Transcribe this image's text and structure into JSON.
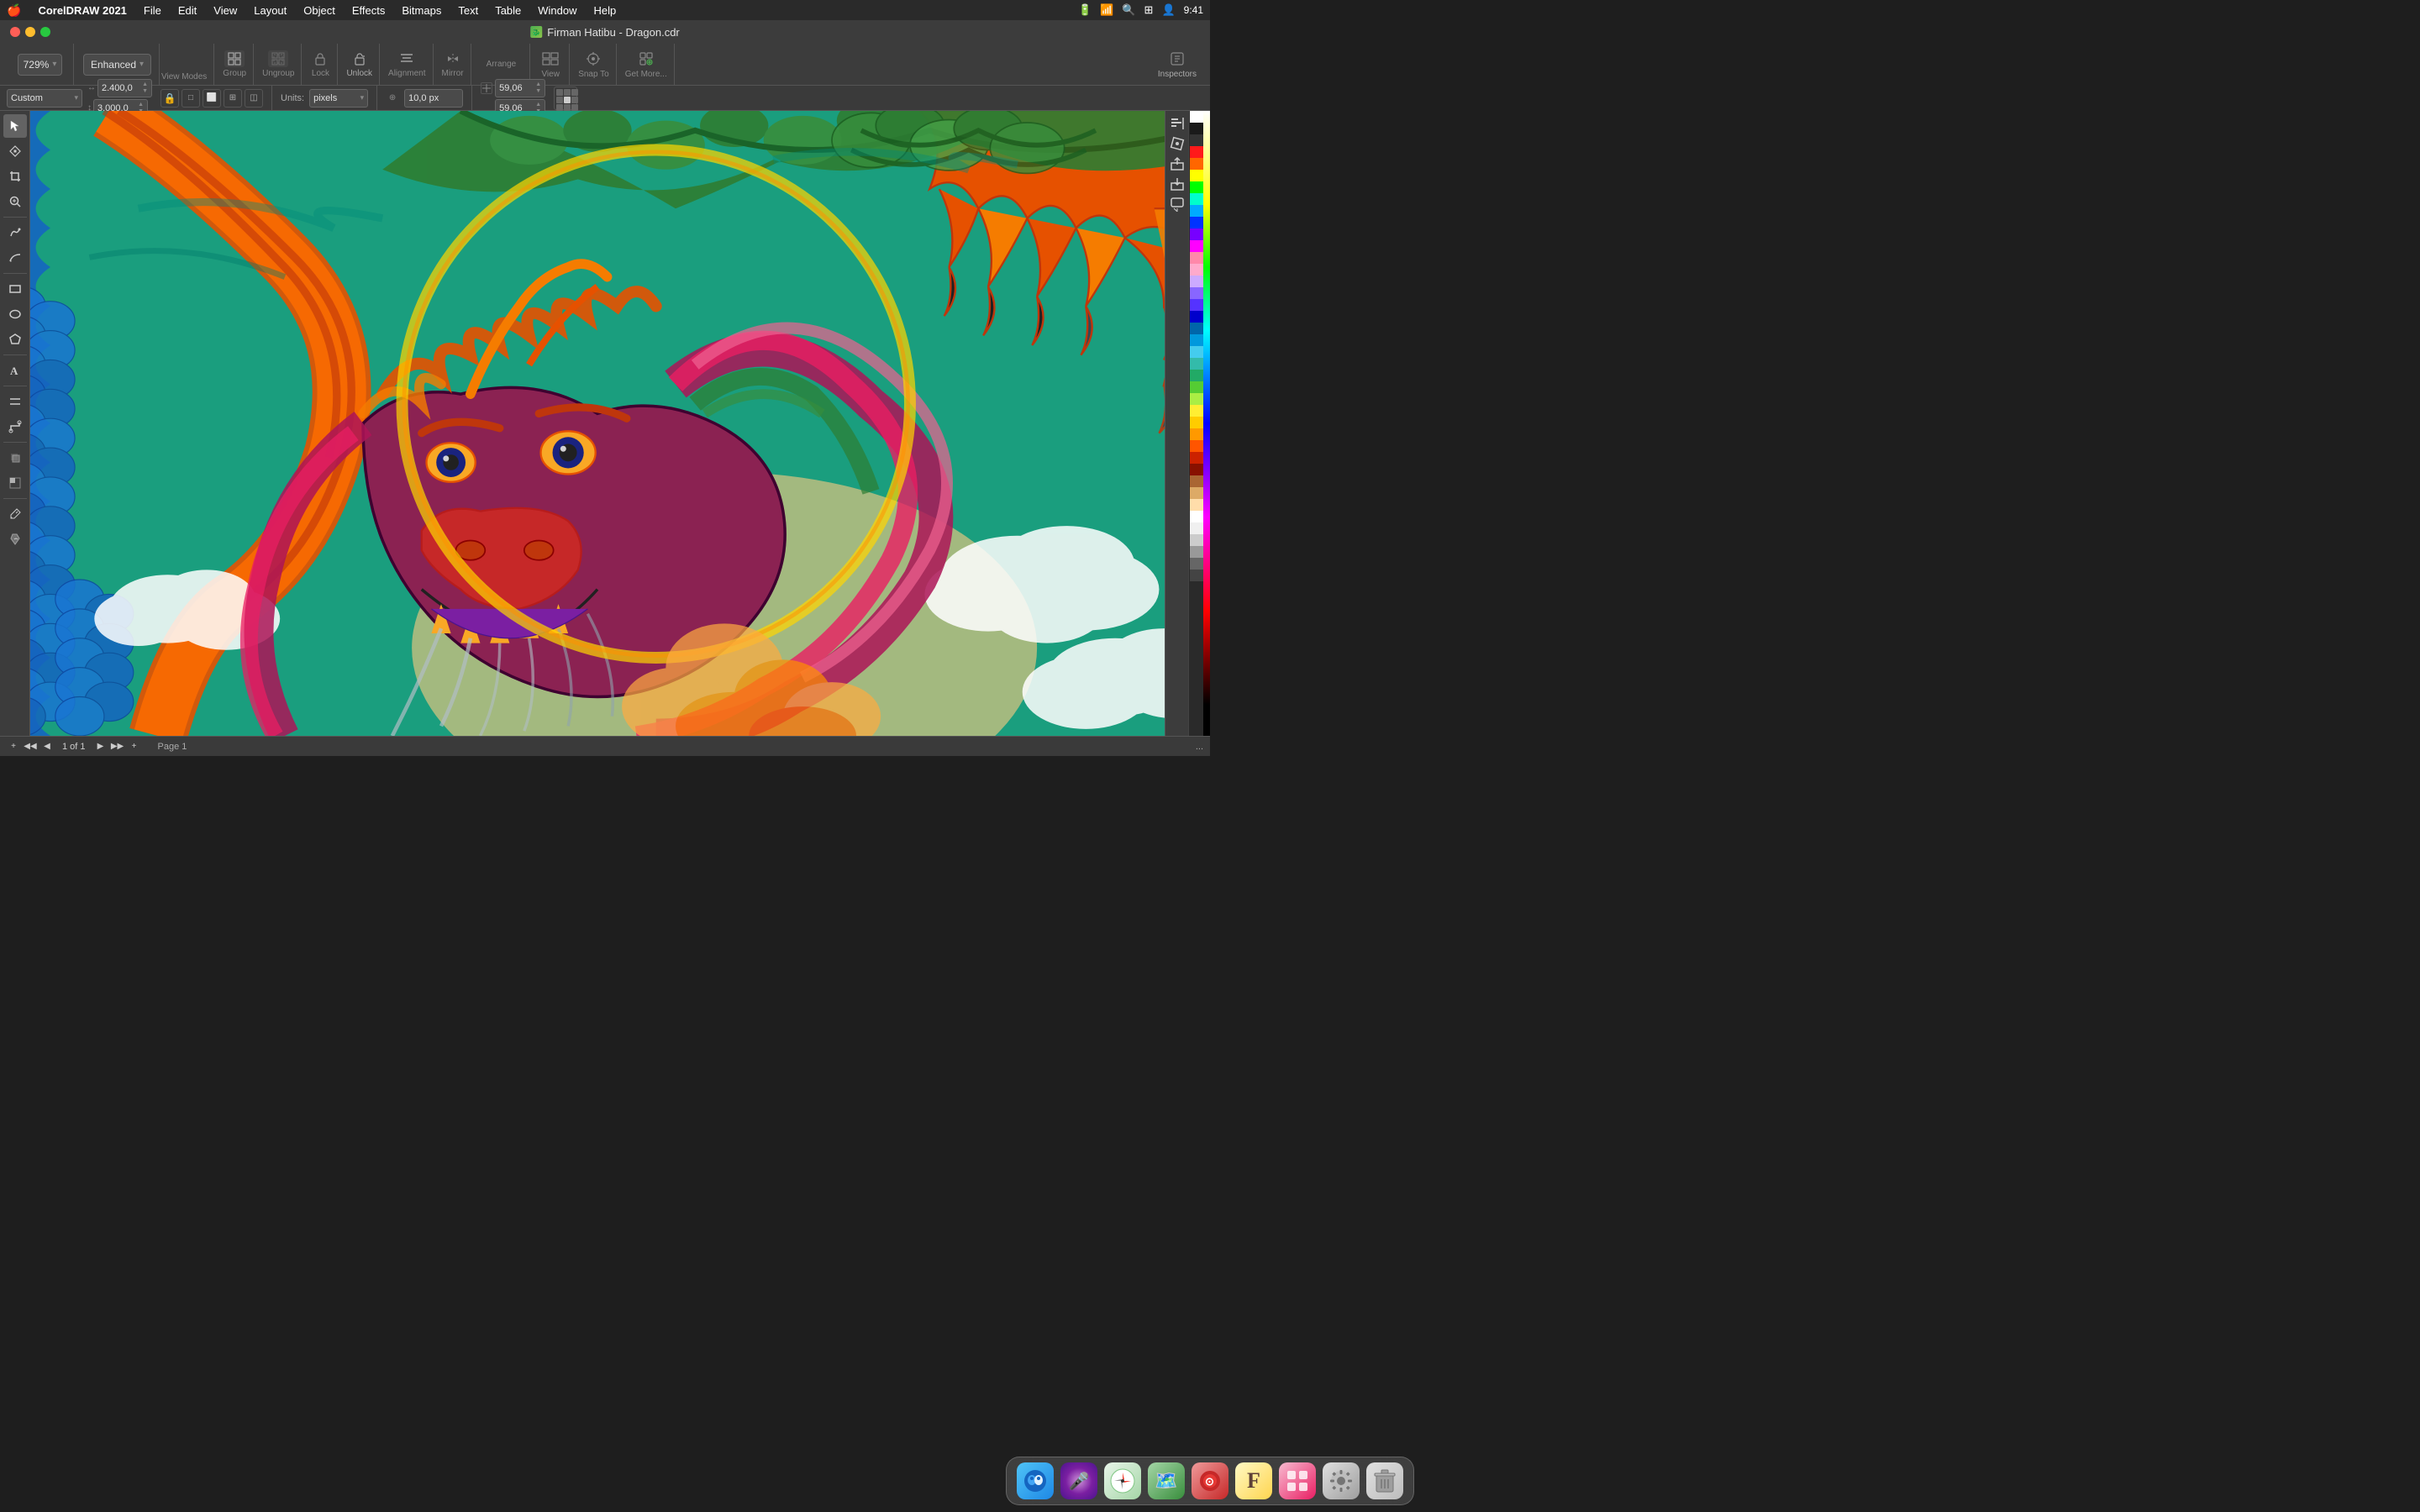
{
  "menubar": {
    "apple": "🍎",
    "app_name": "CorelDRAW 2021",
    "menus": [
      "File",
      "Edit",
      "View",
      "Layout",
      "Object",
      "Effects",
      "Bitmaps",
      "Text",
      "Table",
      "Window",
      "Help"
    ],
    "right_icons": [
      "battery",
      "wifi",
      "search",
      "control",
      "user",
      "clock"
    ]
  },
  "titlebar": {
    "title": "Firman Hatibu - Dragon.cdr",
    "file_icon": "🐉"
  },
  "toolbar": {
    "groups": [
      {
        "name": "zoom",
        "items": [
          {
            "label": "Zoom",
            "icon": "zoom"
          }
        ]
      },
      {
        "name": "view_modes",
        "items": [
          {
            "label": "View Modes",
            "icon": "eye"
          }
        ],
        "zoom_value": "729%",
        "enhanced_value": "Enhanced"
      },
      {
        "name": "group",
        "label": "Group",
        "icon": "group"
      },
      {
        "name": "ungroup",
        "label": "Ungroup",
        "icon": "ungroup"
      },
      {
        "name": "lock",
        "label": "Lock",
        "icon": "lock"
      },
      {
        "name": "unlock",
        "label": "Unlock",
        "icon": "unlock"
      },
      {
        "name": "alignment",
        "label": "Alignment",
        "icon": "align"
      },
      {
        "name": "mirror",
        "label": "Mirror",
        "icon": "mirror"
      },
      {
        "name": "arrange",
        "label": "Arrange",
        "icon": "arrange"
      },
      {
        "name": "view",
        "label": "View",
        "icon": "view"
      },
      {
        "name": "snap_to",
        "label": "Snap To",
        "icon": "snap"
      },
      {
        "name": "get_more",
        "label": "Get More...",
        "icon": "plus"
      },
      {
        "name": "inspectors",
        "label": "Inspectors",
        "icon": "inspector"
      }
    ]
  },
  "property_bar": {
    "preset": "Custom",
    "width": "2.400,0",
    "height": "3.000,0",
    "units": "pixels",
    "nudge": "10,0 px",
    "x": "59,06",
    "y": "59,06",
    "transform_icon": "⊞"
  },
  "canvas": {
    "background_color": "#1a9e7e"
  },
  "status_bar": {
    "add_page": "+",
    "prev_page": "◀",
    "page_indicator": "1 of 1",
    "next_page": "▶",
    "add_page2": "+",
    "page_name": "Page 1",
    "more": "..."
  },
  "color_palette": {
    "swatches": [
      "#ffffff",
      "#000000",
      "#ff0000",
      "#ff6600",
      "#ffff00",
      "#00ff00",
      "#00ffff",
      "#0000ff",
      "#ff00ff",
      "#800000",
      "#804000",
      "#808000",
      "#008000",
      "#008080",
      "#000080",
      "#800080",
      "#ff8080",
      "#ffc080",
      "#ffff80",
      "#80ff80",
      "#80ffff",
      "#8080ff",
      "#ff80ff",
      "#c0c0c0",
      "#808080",
      "#ff4444",
      "#ff8844",
      "#ffcc44",
      "#44ff44",
      "#44ffcc",
      "#4488ff",
      "#cc44ff",
      "#ff4488",
      "#884400",
      "#448800",
      "#004488",
      "#440088",
      "#880044",
      "#336699",
      "#993366"
    ]
  },
  "toolbox": {
    "tools": [
      {
        "name": "pick",
        "icon": "↖",
        "label": "Pick Tool"
      },
      {
        "name": "node-edit",
        "icon": "⬡",
        "label": "Node Edit"
      },
      {
        "name": "crop",
        "icon": "⊡",
        "label": "Crop"
      },
      {
        "name": "zoom-tool",
        "icon": "⌕",
        "label": "Zoom"
      },
      {
        "name": "freehand",
        "icon": "✏",
        "label": "Freehand"
      },
      {
        "name": "smart-draw",
        "icon": "⌒",
        "label": "Smart Draw"
      },
      {
        "name": "rectangle",
        "icon": "□",
        "label": "Rectangle"
      },
      {
        "name": "ellipse",
        "icon": "○",
        "label": "Ellipse"
      },
      {
        "name": "polygon",
        "icon": "⬡",
        "label": "Polygon"
      },
      {
        "name": "text-tool",
        "icon": "A",
        "label": "Text"
      },
      {
        "name": "parallel",
        "icon": "//",
        "label": "Parallel"
      },
      {
        "name": "connector",
        "icon": "⌇",
        "label": "Connector"
      },
      {
        "name": "shadow",
        "icon": "◧",
        "label": "Shadow"
      },
      {
        "name": "transparency",
        "icon": "◈",
        "label": "Transparency"
      },
      {
        "name": "eyedropper",
        "icon": "💧",
        "label": "Eyedropper"
      },
      {
        "name": "fill",
        "icon": "🪣",
        "label": "Fill"
      }
    ]
  },
  "dock": {
    "apps": [
      {
        "name": "finder",
        "color": "#1e88e5",
        "icon": "🔵",
        "label": "Finder"
      },
      {
        "name": "siri",
        "color": "#7b68ee",
        "icon": "🎤",
        "label": "Siri"
      },
      {
        "name": "safari",
        "color": "#4CAF50",
        "icon": "🧭",
        "label": "Safari"
      },
      {
        "name": "maps",
        "color": "#4CAF50",
        "icon": "🗺",
        "label": "Maps"
      },
      {
        "name": "rededem",
        "color": "#e53935",
        "icon": "🔴",
        "label": "App"
      },
      {
        "name": "fontbook",
        "color": "#FF9800",
        "icon": "F",
        "label": "Fontbook"
      },
      {
        "name": "launchpad",
        "color": "#e91e63",
        "icon": "⊞",
        "label": "Launchpad"
      },
      {
        "name": "preferences",
        "color": "#9e9e9e",
        "icon": "⚙",
        "label": "System Preferences"
      },
      {
        "name": "trash",
        "color": "#888",
        "icon": "🗑",
        "label": "Trash"
      }
    ]
  }
}
